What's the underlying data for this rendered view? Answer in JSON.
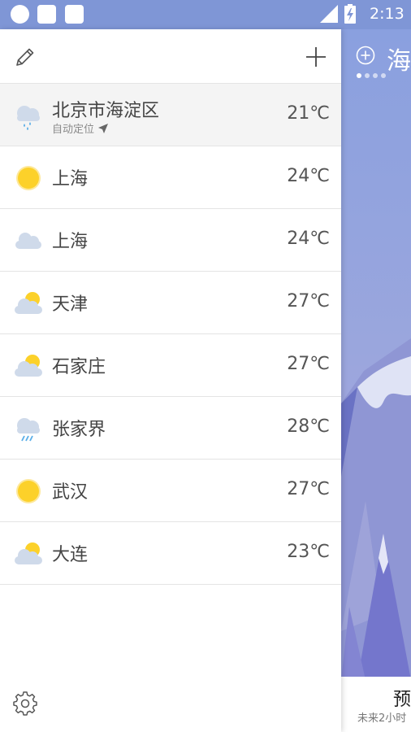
{
  "status_bar": {
    "time": "2:13",
    "icons": [
      "notification-circle-icon",
      "notification-square-icon",
      "notification-square-icon",
      "signal-icon",
      "battery-charging-icon"
    ]
  },
  "background": {
    "city_partial": "海",
    "forecast_partial": "预",
    "subtitle_partial": "未来2小时",
    "page_dots": 4,
    "active_dot": 0
  },
  "drawer": {
    "header": {
      "edit_icon": "pencil-icon",
      "add_icon": "plus-icon"
    },
    "cities": [
      {
        "name": "北京市海淀区",
        "sub": "自动定位",
        "temp": "21℃",
        "icon": "cloud-rain-icon",
        "current": true
      },
      {
        "name": "上海",
        "temp": "24℃",
        "icon": "sun-icon"
      },
      {
        "name": "上海",
        "temp": "24℃",
        "icon": "cloud-icon"
      },
      {
        "name": "天津",
        "temp": "27℃",
        "icon": "partly-cloudy-icon"
      },
      {
        "name": "石家庄",
        "temp": "27℃",
        "icon": "partly-cloudy-icon"
      },
      {
        "name": "张家界",
        "temp": "28℃",
        "icon": "cloud-rain-icon"
      },
      {
        "name": "武汉",
        "temp": "27℃",
        "icon": "sun-icon"
      },
      {
        "name": "大连",
        "temp": "23℃",
        "icon": "partly-cloudy-icon"
      }
    ],
    "settings_icon": "gear-icon"
  },
  "colors": {
    "status_bar": "#7f96d6",
    "sun": "#fcd12a",
    "cloud": "#cfdaea",
    "rain": "#5aaee8"
  }
}
